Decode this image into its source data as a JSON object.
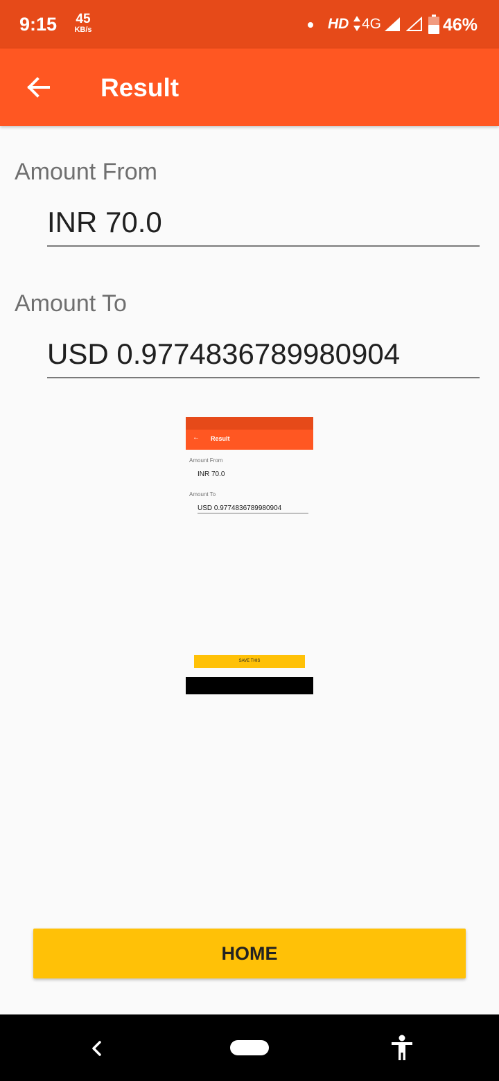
{
  "status_bar": {
    "time": "9:15",
    "speed_value": "45",
    "speed_unit": "KB/s",
    "hd": "HD",
    "network": "4G",
    "battery": "46%"
  },
  "app_bar": {
    "title": "Result",
    "back_icon": "arrow-left-icon"
  },
  "form": {
    "from_label": "Amount From",
    "from_value": "INR 70.0",
    "to_label": "Amount To",
    "to_value": "USD 0.9774836789980904"
  },
  "preview": {
    "title": "Result",
    "from_label": "Amount From",
    "from_value": "INR 70.0",
    "to_label": "Amount To",
    "to_value": "USD 0.9774836789980904",
    "save_label": "SAVE THIS"
  },
  "home_button": {
    "label": "HOME"
  },
  "colors": {
    "status_bar": "#e64a19",
    "app_bar": "#ff5722",
    "button": "#ffc107",
    "background": "#fafafa"
  }
}
